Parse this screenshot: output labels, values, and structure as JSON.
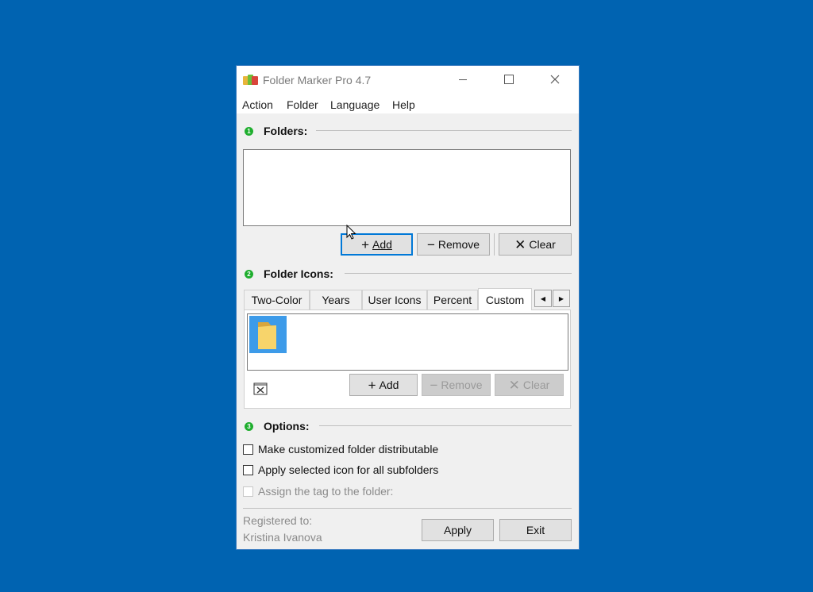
{
  "window": {
    "title": "Folder Marker Pro 4.7",
    "controls": {
      "minimize": "—",
      "maximize": "☐",
      "close": "✕"
    }
  },
  "menu": [
    "Action",
    "Folder",
    "Language",
    "Help"
  ],
  "sections": {
    "folders": {
      "number": "1",
      "label": "Folders:"
    },
    "icons": {
      "number": "2",
      "label": "Folder Icons:"
    },
    "options": {
      "number": "3",
      "label": "Options:"
    }
  },
  "folders_buttons": {
    "add": "Add",
    "remove": "Remove",
    "clear": "Clear"
  },
  "tabs": [
    "Two-Color",
    "Years",
    "User Icons",
    "Percent",
    "Custom"
  ],
  "active_tab": "Custom",
  "icon_buttons": {
    "add": "Add",
    "remove": "Remove",
    "clear": "Clear"
  },
  "options": [
    "Make customized folder distributable",
    "Apply selected icon for all subfolders",
    "Assign the tag to the folder:"
  ],
  "registration": {
    "label": "Registered to:",
    "name": "Kristina Ivanova"
  },
  "footer_buttons": {
    "apply": "Apply",
    "exit": "Exit"
  },
  "colors": {
    "desktop": "#0063b1",
    "section_bullet": "#1fae2e",
    "focus_border": "#0078d7",
    "selected_icon_bg": "#3d9be9",
    "folder_yellow": "#f7d46b"
  }
}
